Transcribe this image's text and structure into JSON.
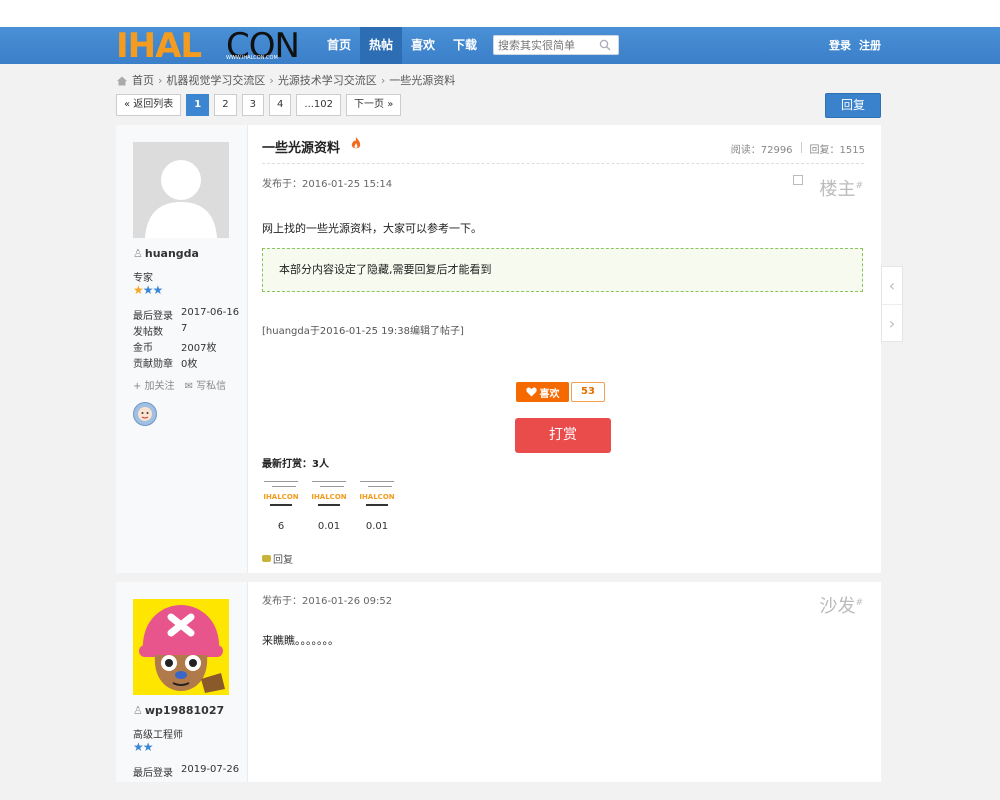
{
  "header": {
    "logo_left": "IHAL",
    "logo_right": "CON",
    "logo_url": "WWW.IHALCON.COM",
    "nav": [
      {
        "label": "首页"
      },
      {
        "label": "热帖",
        "active": true
      },
      {
        "label": "喜欢"
      },
      {
        "label": "下载"
      }
    ],
    "search_placeholder": "搜索其实很简单",
    "login": "登录",
    "register": "注册"
  },
  "breadcrumb": [
    "首页",
    "机器视觉学习交流区",
    "光源技术学习交流区",
    "一些光源资料"
  ],
  "pager": {
    "back": "« 返回列表",
    "pages": [
      "1",
      "2",
      "3",
      "4",
      "...102"
    ],
    "current": "1",
    "next": "下一页 »"
  },
  "reply_button": "回复",
  "thread": {
    "title": "一些光源资料",
    "views_label": "阅读：72996",
    "replies_label": "回复：1515"
  },
  "posts": [
    {
      "username": "huangda",
      "rank": "专家",
      "stars_gold": "★",
      "stars_blue": "★★",
      "stats": [
        {
          "k": "最后登录",
          "v": "2017-06-16"
        },
        {
          "k": "发帖数",
          "v": "7"
        },
        {
          "k": "金币",
          "v": "2007枚"
        },
        {
          "k": "贡献勋章",
          "v": "0枚"
        }
      ],
      "follow": "+ 加关注",
      "message": "✉ 写私信",
      "published": "发布于：2016-01-25 15:14",
      "floor": "楼主",
      "body": "网上找的一些光源资料，大家可以参考一下。",
      "hidden_note": "本部分内容设定了隐藏,需要回复后才能看到",
      "edit_note": "[huangda于2016-01-25 19:38编辑了帖子]",
      "like_label": "喜欢",
      "like_count": "53",
      "reward_label": "打赏",
      "latest_reward": "最新打赏：3人",
      "tippers": [
        {
          "logo": "IHALCON",
          "value": "6"
        },
        {
          "logo": "IHALCON",
          "value": "0.01"
        },
        {
          "logo": "IHALCON",
          "value": "0.01"
        }
      ],
      "reply_link": "回复"
    },
    {
      "username": "wp19881027",
      "rank": "高级工程师",
      "stars_blue": "★★",
      "last_login_label": "最后登录",
      "last_login": "2019-07-26",
      "published": "发布于：2016-01-26 09:52",
      "floor": "沙发",
      "body": "来瞧瞧。。。。。。。"
    }
  ],
  "floor_mark": "#"
}
